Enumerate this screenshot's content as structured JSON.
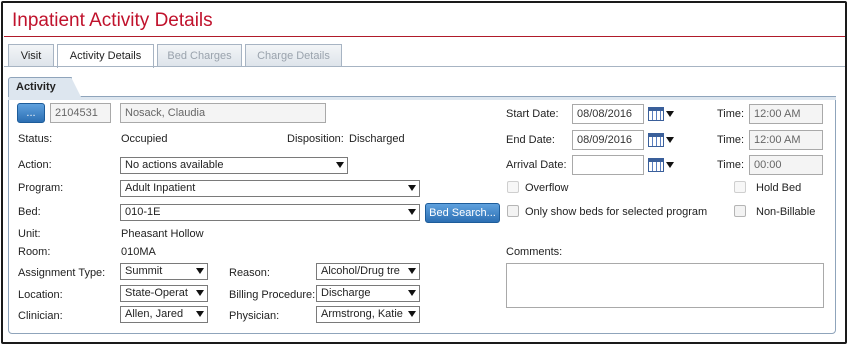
{
  "page": {
    "title": "Inpatient Activity Details"
  },
  "tabs": [
    {
      "label": "Visit",
      "state": "normal"
    },
    {
      "label": "Activity Details",
      "state": "active"
    },
    {
      "label": "Bed Charges",
      "state": "disabled"
    },
    {
      "label": "Charge Details",
      "state": "disabled"
    }
  ],
  "activity": {
    "section_label": "Activity",
    "client_button_label": "...",
    "client_id": "2104531",
    "client_name": "Nosack, Claudia",
    "status_label": "Status:",
    "status_value": "Occupied",
    "disposition_label": "Disposition:",
    "disposition_value": "Discharged",
    "action_label": "Action:",
    "action_value": "No actions available",
    "program_label": "Program:",
    "program_value": "Adult Inpatient",
    "bed_label": "Bed:",
    "bed_value": "010-1E",
    "bed_search_label": "Bed Search...",
    "unit_label": "Unit:",
    "unit_value": "Pheasant Hollow",
    "room_label": "Room:",
    "room_value": "010MA",
    "assignment_type_label": "Assignment Type:",
    "assignment_type_value": "Summit",
    "reason_label": "Reason:",
    "reason_value": "Alcohol/Drug tre",
    "location_label": "Location:",
    "location_value": "State-Operat",
    "billing_procedure_label": "Billing Procedure:",
    "billing_procedure_value": "Discharge",
    "clinician_label": "Clinician:",
    "clinician_value": "Allen, Jared",
    "physician_label": "Physician:",
    "physician_value": "Armstrong, Katie"
  },
  "dates": {
    "start_date_label": "Start Date:",
    "start_date_value": "08/08/2016",
    "start_time_label": "Time:",
    "start_time_value": "12:00 AM",
    "end_date_label": "End Date:",
    "end_date_value": "08/09/2016",
    "end_time_label": "Time:",
    "end_time_value": "12:00 AM",
    "arrival_date_label": "Arrival Date:",
    "arrival_date_value": "",
    "arrival_time_label": "Time:",
    "arrival_time_value": "00:00"
  },
  "options": {
    "overflow_label": "Overflow",
    "hold_bed_label": "Hold Bed",
    "only_program_beds_label": "Only show beds for selected program",
    "non_billable_label": "Non-Billable"
  },
  "comments": {
    "label": "Comments:",
    "value": ""
  },
  "icons": {
    "calendar": "calendar-icon",
    "dropdown": "chevron-down-icon"
  },
  "colors": {
    "title_red": "#c0122c",
    "button_blue": "#2c6fb3",
    "panel_header": "#dde6ef"
  }
}
